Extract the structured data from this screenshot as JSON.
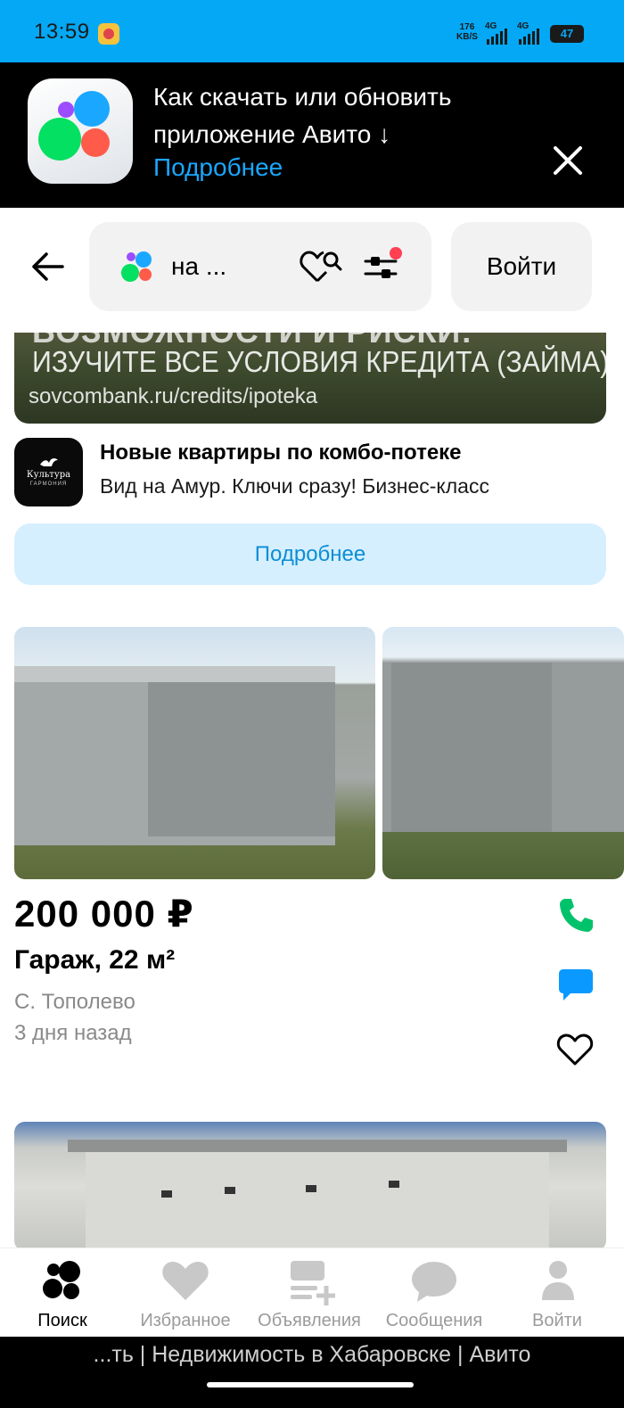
{
  "status_bar": {
    "time": "13:59",
    "net_speed_value": "176",
    "net_speed_unit": "KB/S",
    "sim1": "4G",
    "sim2": "4G",
    "battery": "47"
  },
  "promo_banner": {
    "title": "Как скачать или обновить приложение Авито ↓",
    "link": "Подробнее",
    "icon": "avito-app-logo"
  },
  "header": {
    "back_icon": "arrow-left-icon",
    "search_query": "на ...",
    "save_search_icon": "heart-search-icon",
    "filters_icon": "sliders-icon",
    "login_label": "Войти"
  },
  "ad": {
    "image_text_top": "ВОЗМОЖНОСТИ И РИСКИ:",
    "image_text_main": "ИЗУЧИТЕ ВСЕ УСЛОВИЯ КРЕДИТА (ЗАЙМА):",
    "image_text_url": "sovcombank.ru/credits/ipoteka",
    "logo_text": "Культура",
    "logo_subtext": "ГАРМОНИЯ",
    "title": "Новые квартиры по комбо-потеке",
    "subtitle": "Вид на Амур. Ключи сразу! Бизнес-класс",
    "button": "Подробнее"
  },
  "listing": {
    "price": "200 000 ₽",
    "title": "Гараж, 22 м²",
    "location": "С. Тополево",
    "date": "3 дня назад",
    "actions": [
      "phone-icon",
      "chat-icon",
      "heart-icon"
    ],
    "colors": {
      "phone": "#00c26a",
      "chat": "#0a99ff"
    }
  },
  "bottom_nav": {
    "items": [
      {
        "label": "Поиск",
        "icon": "search-dots-icon",
        "active": true
      },
      {
        "label": "Избранное",
        "icon": "heart-icon",
        "active": false
      },
      {
        "label": "Объявления",
        "icon": "add-listing-icon",
        "active": false
      },
      {
        "label": "Сообщения",
        "icon": "chat-bubble-icon",
        "active": false
      },
      {
        "label": "Войти",
        "icon": "profile-icon",
        "active": false
      }
    ]
  },
  "page_title": "...ть | Недвижимость в Хабаровске | Авито",
  "theme": {
    "brand_blue": "#04a8f5",
    "link_blue": "#1aa7ff"
  }
}
